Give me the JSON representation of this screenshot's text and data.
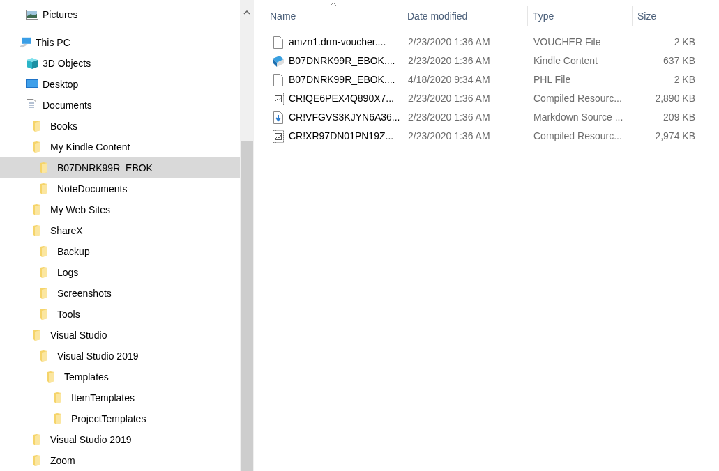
{
  "nav_tree": [
    {
      "label": "Pictures",
      "kind": "pictures",
      "selected": false
    },
    {
      "label": "This PC",
      "kind": "pc",
      "selected": false,
      "children": [
        {
          "label": "3D Objects",
          "kind": "cube",
          "selected": false
        },
        {
          "label": "Desktop",
          "kind": "desktop",
          "selected": false
        },
        {
          "label": "Documents",
          "kind": "documents",
          "selected": false,
          "children": [
            {
              "label": "Books",
              "kind": "folder",
              "selected": false
            },
            {
              "label": "My Kindle Content",
              "kind": "folder",
              "selected": false,
              "children": [
                {
                  "label": "B07DNRK99R_EBOK",
                  "kind": "folder",
                  "selected": true
                },
                {
                  "label": "NoteDocuments",
                  "kind": "folder",
                  "selected": false
                }
              ]
            },
            {
              "label": "My Web Sites",
              "kind": "folder",
              "selected": false
            },
            {
              "label": "ShareX",
              "kind": "folder",
              "selected": false,
              "children": [
                {
                  "label": "Backup",
                  "kind": "folder",
                  "selected": false
                },
                {
                  "label": "Logs",
                  "kind": "folder",
                  "selected": false
                },
                {
                  "label": "Screenshots",
                  "kind": "folder",
                  "selected": false
                },
                {
                  "label": "Tools",
                  "kind": "folder",
                  "selected": false
                }
              ]
            },
            {
              "label": "Visual Studio",
              "kind": "folder",
              "selected": false,
              "children": [
                {
                  "label": "Visual Studio 2019",
                  "kind": "folder",
                  "selected": false,
                  "children": [
                    {
                      "label": "Templates",
                      "kind": "folder",
                      "selected": false,
                      "children": [
                        {
                          "label": "ItemTemplates",
                          "kind": "folder",
                          "selected": false
                        },
                        {
                          "label": "ProjectTemplates",
                          "kind": "folder",
                          "selected": false
                        }
                      ]
                    }
                  ]
                }
              ]
            },
            {
              "label": "Visual Studio 2019",
              "kind": "folder",
              "selected": false
            },
            {
              "label": "Zoom",
              "kind": "folder",
              "selected": false
            }
          ]
        }
      ]
    }
  ],
  "file_list": {
    "columns": [
      "Name",
      "Date modified",
      "Type",
      "Size"
    ],
    "rows": [
      {
        "kind": "blank",
        "name": "amzn1.drm-voucher....",
        "date": "2/23/2020 1:36 AM",
        "type": "VOUCHER File",
        "size": "2 KB"
      },
      {
        "kind": "book",
        "name": "B07DNRK99R_EBOK....",
        "date": "2/23/2020 1:36 AM",
        "type": "Kindle Content",
        "size": "637 KB"
      },
      {
        "kind": "blank",
        "name": "B07DNRK99R_EBOK....",
        "date": "4/18/2020 9:34 AM",
        "type": "PHL File",
        "size": "2 KB"
      },
      {
        "kind": "resource",
        "name": "CR!QE6PEX4Q890X7...",
        "date": "2/23/2020 1:36 AM",
        "type": "Compiled Resourc...",
        "size": "2,890 KB"
      },
      {
        "kind": "markdown",
        "name": "CR!VFGVS3KJYN6A36...",
        "date": "2/23/2020 1:36 AM",
        "type": "Markdown Source ...",
        "size": "209 KB"
      },
      {
        "kind": "resource",
        "name": "CR!XR97DN01PN19Z...",
        "date": "2/23/2020 1:36 AM",
        "type": "Compiled Resourc...",
        "size": "2,974 KB"
      }
    ]
  }
}
